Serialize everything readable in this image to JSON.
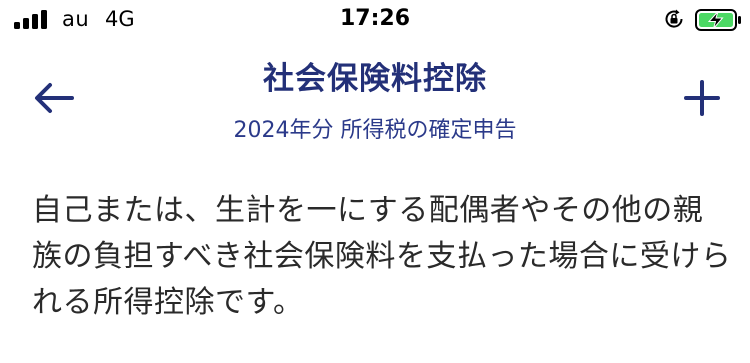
{
  "status_bar": {
    "carrier": "au",
    "network": "4G",
    "time": "17:26"
  },
  "nav": {
    "title": "社会保険料控除",
    "subtitle": "2024年分 所得税の確定申告",
    "back_icon": "arrow-left-icon",
    "add_icon": "plus-icon",
    "accent_color": "#233078"
  },
  "content": {
    "description": "自己または、生計を一にする配偶者やその他の親族の負担すべき社会保険料を支払った場合に受けられる所得控除です。"
  }
}
